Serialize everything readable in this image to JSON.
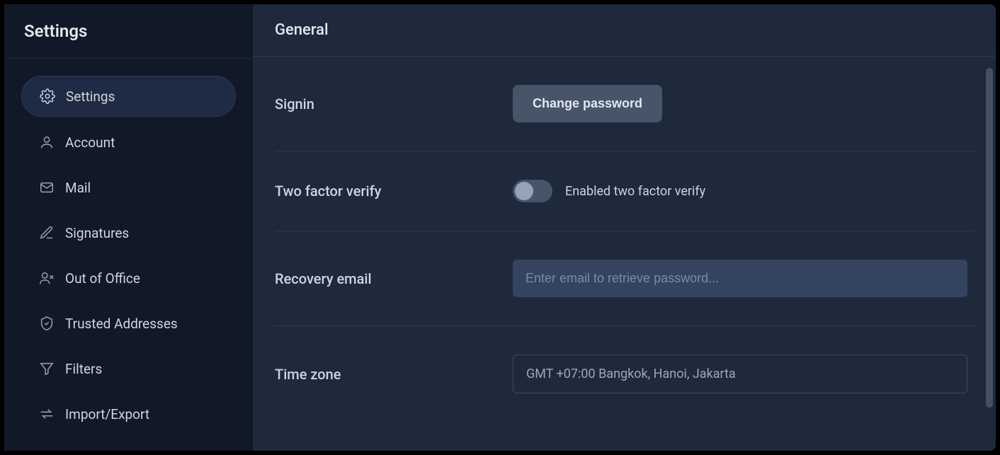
{
  "sidebar": {
    "title": "Settings",
    "items": [
      {
        "label": "Settings",
        "active": true
      },
      {
        "label": "Account",
        "active": false
      },
      {
        "label": "Mail",
        "active": false
      },
      {
        "label": "Signatures",
        "active": false
      },
      {
        "label": "Out of Office",
        "active": false
      },
      {
        "label": "Trusted Addresses",
        "active": false
      },
      {
        "label": "Filters",
        "active": false
      },
      {
        "label": "Import/Export",
        "active": false
      }
    ]
  },
  "main": {
    "title": "General",
    "sections": {
      "signin": {
        "label": "Signin",
        "button": "Change password"
      },
      "two_factor": {
        "label": "Two factor verify",
        "toggle_label": "Enabled two factor verify"
      },
      "recovery": {
        "label": "Recovery email",
        "placeholder": "Enter email to retrieve password..."
      },
      "timezone": {
        "label": "Time zone",
        "value": "GMT +07:00 Bangkok, Hanoi, Jakarta"
      }
    }
  }
}
